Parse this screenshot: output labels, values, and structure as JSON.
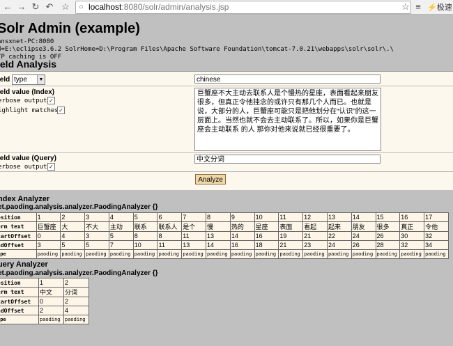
{
  "browser": {
    "url_host": "localhost",
    "url_path": ":8080/solr/admin/analysis.jsp",
    "speed_label": "极速"
  },
  "page": {
    "title": "Solr Admin (example)",
    "info_lines": [
      "ansxnet-PC:8080",
      "d=E:\\eclipse3.6.2 SolrHome=D:\\Program Files\\Apache Software Foundation\\tomcat-7.0.21\\webapps\\solr\\solr\\.\\",
      "TP caching is OFF"
    ],
    "section_title": "ield Analysis"
  },
  "form": {
    "field_label": "ield",
    "field_type_value": "type",
    "field_name_value": "chinese",
    "index_label": "ield value (Index)",
    "verbose_label": "erbose output",
    "highlight_label": "ighlight matches",
    "index_text": "巨蟹座不大主动去联系人是个慢热的星座，表面看起来朋友很多，但真正令他挂念的或许只有那几个人而已。也就是说，大部分的人，巨蟹座可能只是把他划分在“认识”的这一层面上。当然也就不会去主动联系了。所以，如果你是巨蟹座会主动联系 的人 那你对他来说就已经很重要了。",
    "query_label": "ield value (Query)",
    "query_verbose_label": "erbose output",
    "query_text": "中文分词",
    "analyze_button": "Analyze"
  },
  "index_analyzer": {
    "heading": "ndex Analyzer",
    "class_name": "et.paoding.analysis.analyzer.PaodingAnalyzer {}",
    "row_labels": [
      "osition",
      "erm text",
      "tartOffset",
      "ndOffset",
      "ype"
    ],
    "columns": [
      {
        "position": "1",
        "term": "巨蟹座",
        "start": "0",
        "end": "3",
        "type": "paoding"
      },
      {
        "position": "2",
        "term": "大",
        "start": "4",
        "end": "5",
        "type": "paoding"
      },
      {
        "position": "3",
        "term": "不大",
        "start": "3",
        "end": "5",
        "type": "paoding"
      },
      {
        "position": "4",
        "term": "主动",
        "start": "5",
        "end": "7",
        "type": "paoding"
      },
      {
        "position": "5",
        "term": "联系",
        "start": "8",
        "end": "10",
        "type": "paoding"
      },
      {
        "position": "6",
        "term": "联系人",
        "start": "8",
        "end": "11",
        "type": "paoding"
      },
      {
        "position": "7",
        "term": "是个",
        "start": "11",
        "end": "13",
        "type": "paoding"
      },
      {
        "position": "8",
        "term": "慢",
        "start": "13",
        "end": "14",
        "type": "paoding"
      },
      {
        "position": "9",
        "term": "热的",
        "start": "14",
        "end": "16",
        "type": "paoding"
      },
      {
        "position": "10",
        "term": "星座",
        "start": "16",
        "end": "18",
        "type": "paoding"
      },
      {
        "position": "11",
        "term": "表面",
        "start": "19",
        "end": "21",
        "type": "paoding"
      },
      {
        "position": "12",
        "term": "看起",
        "start": "21",
        "end": "23",
        "type": "paoding"
      },
      {
        "position": "13",
        "term": "起来",
        "start": "22",
        "end": "24",
        "type": "paoding"
      },
      {
        "position": "14",
        "term": "朋友",
        "start": "24",
        "end": "26",
        "type": "paoding"
      },
      {
        "position": "15",
        "term": "很多",
        "start": "26",
        "end": "28",
        "type": "paoding"
      },
      {
        "position": "16",
        "term": "真正",
        "start": "30",
        "end": "32",
        "type": "paoding"
      },
      {
        "position": "17",
        "term": "令他",
        "start": "32",
        "end": "34",
        "type": "paoding"
      }
    ]
  },
  "query_analyzer": {
    "heading": "uery Analyzer",
    "class_name": "et.paoding.analysis.analyzer.PaodingAnalyzer {}",
    "row_labels": [
      "osition",
      "erm text",
      "tartOffset",
      "ndOffset",
      "ype"
    ],
    "columns": [
      {
        "position": "1",
        "term": "中文",
        "start": "0",
        "end": "2",
        "type": "paoding"
      },
      {
        "position": "2",
        "term": "分词",
        "start": "2",
        "end": "4",
        "type": "paoding"
      }
    ]
  }
}
